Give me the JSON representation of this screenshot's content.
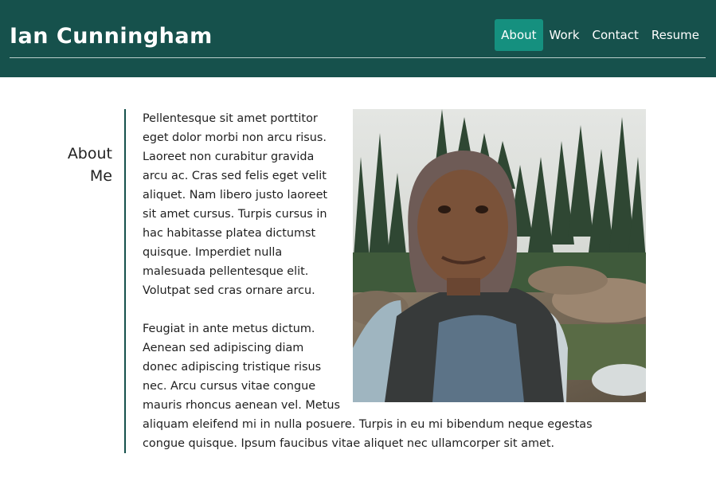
{
  "header": {
    "title": "Ian Cunningham",
    "nav": [
      {
        "label": "About",
        "active": true
      },
      {
        "label": "Work"
      },
      {
        "label": "Contact"
      },
      {
        "label": "Resume"
      }
    ]
  },
  "about": {
    "heading_line1": "About",
    "heading_line2": "Me",
    "paragraph1": "Pellentesque sit amet porttitor eget dolor morbi non arcu risus. Laoreet non curabitur gravida arcu ac. Cras sed felis eget velit aliquet. Nam libero justo laoreet sit amet cursus. Turpis cursus in hac habitasse platea dictumst quisque. Imperdiet nulla malesuada pellentesque elit. Volutpat sed cras ornare arcu.",
    "paragraph2": "Feugiat in ante metus dictum. Aenean sed adipiscing diam donec adipiscing tristique risus nec. Arcu cursus vitae congue mauris rhoncus aenean vel. Metus aliquam eleifend mi in nulla posuere. Turpis in eu mi bibendum neque egestas congue quisque. Ipsum faucibus vitae aliquet nec ullamcorper sit amet."
  },
  "colors": {
    "header_bg": "#16514c",
    "nav_active_bg": "#15907f",
    "divider": "#16514c"
  }
}
